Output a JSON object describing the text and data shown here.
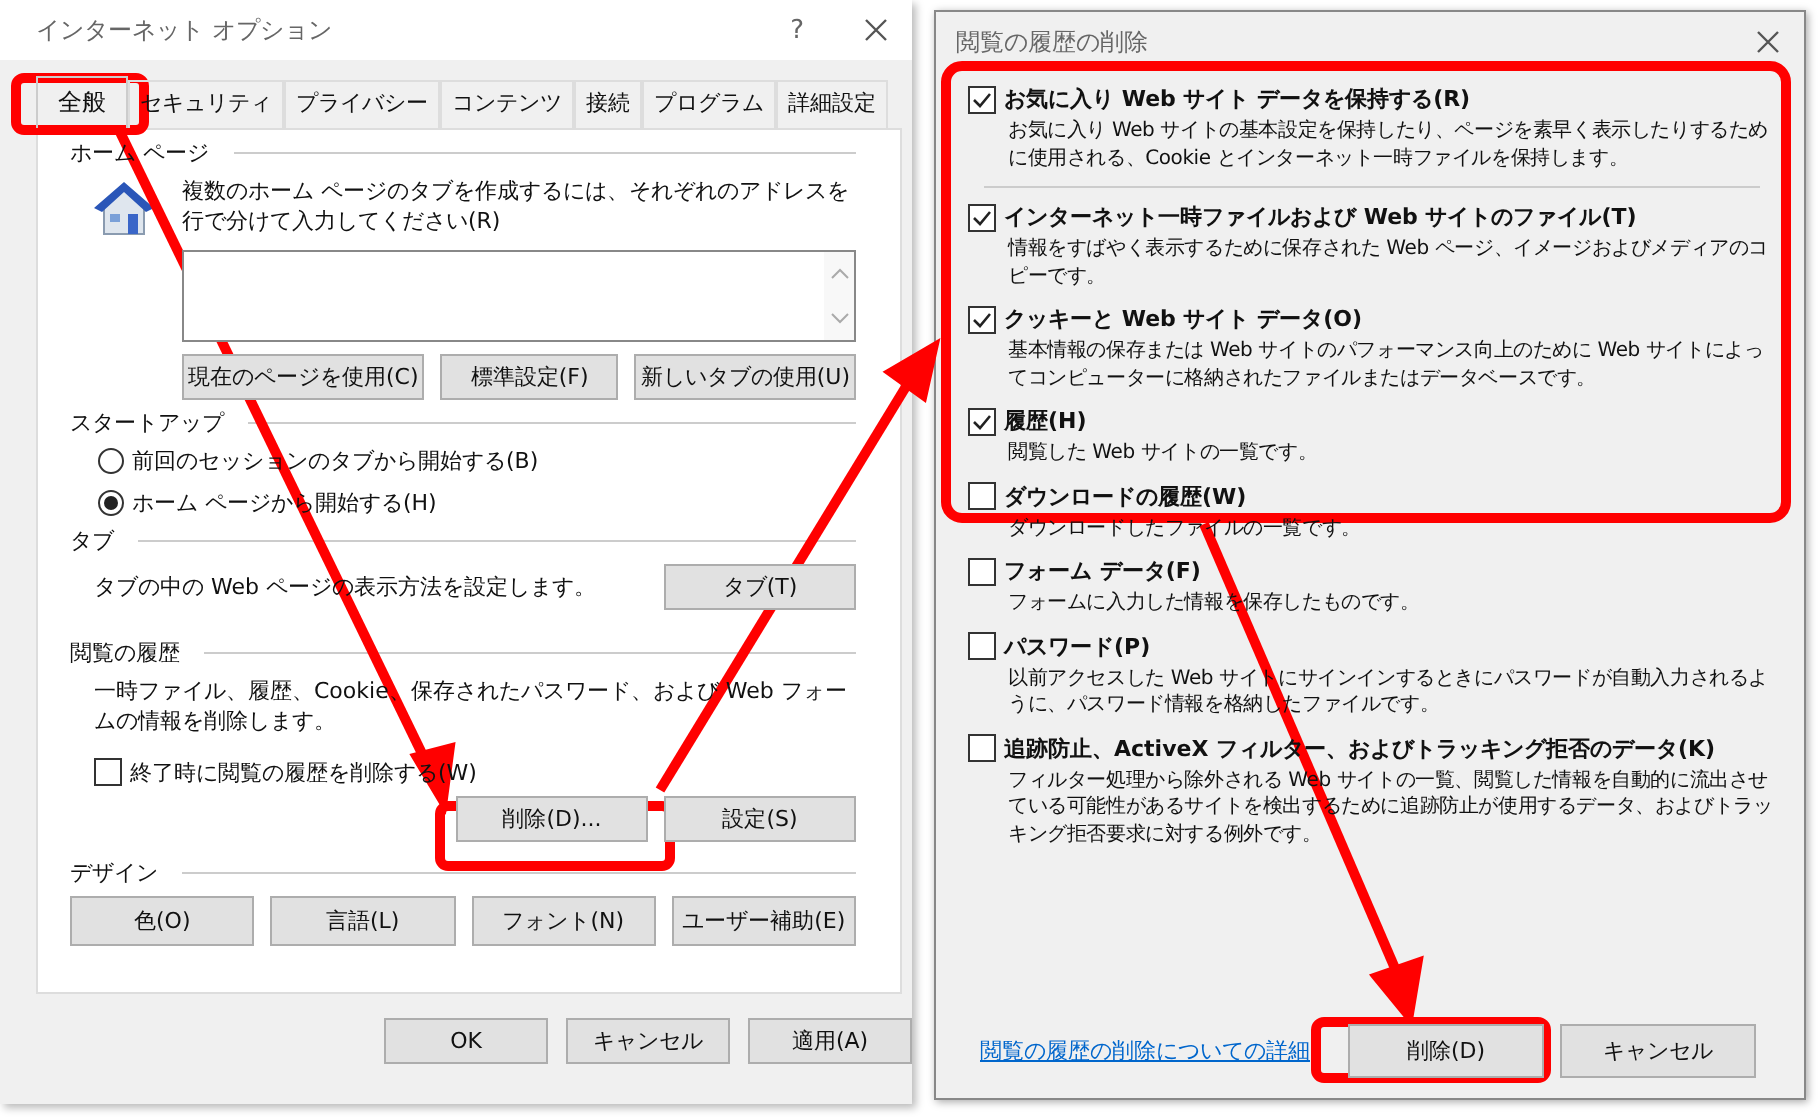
{
  "options_window": {
    "title": "インターネット オプション",
    "help": "?",
    "tabs": [
      {
        "label": "全般",
        "selected": true
      },
      {
        "label": "セキュリティ",
        "selected": false
      },
      {
        "label": "プライバシー",
        "selected": false
      },
      {
        "label": "コンテンツ",
        "selected": false
      },
      {
        "label": "接続",
        "selected": false
      },
      {
        "label": "プログラム",
        "selected": false
      },
      {
        "label": "詳細設定",
        "selected": false
      }
    ],
    "home_page": {
      "heading": "ホーム ページ",
      "description": "複数のホーム ページのタブを作成するには、それぞれのアドレスを行で分けて入力してください(R)",
      "buttons": [
        "現在のページを使用(C)",
        "標準設定(F)",
        "新しいタブの使用(U)"
      ]
    },
    "startup": {
      "heading": "スタートアップ",
      "options": [
        {
          "label": "前回のセッションのタブから開始する(B)",
          "selected": false
        },
        {
          "label": "ホーム ページから開始する(H)",
          "selected": true
        }
      ]
    },
    "tabs_section": {
      "heading": "タブ",
      "description": "タブの中の Web ページの表示方法を設定します。",
      "button": "タブ(T)"
    },
    "history": {
      "heading": "閲覧の履歴",
      "description": "一時ファイル、履歴、Cookie、保存されたパスワード、および Web フォームの情報を削除します。",
      "checkbox": {
        "label": "終了時に閲覧の履歴を削除する(W)",
        "checked": false
      },
      "buttons": [
        "削除(D)...",
        "設定(S)"
      ]
    },
    "design": {
      "heading": "デザイン",
      "buttons": [
        "色(O)",
        "言語(L)",
        "フォント(N)",
        "ユーザー補助(E)"
      ]
    },
    "footer_buttons": [
      "OK",
      "キャンセル",
      "適用(A)"
    ]
  },
  "delete_window": {
    "title": "閲覧の履歴の削除",
    "items": [
      {
        "label": "お気に入り Web サイト データを保持する(R)",
        "checked": true,
        "description": "お気に入り Web サイトの基本設定を保持したり、ページを素早く表示したりするために使用される、Cookie とインターネット一時ファイルを保持します。"
      },
      {
        "label": "インターネット一時ファイルおよび Web サイトのファイル(T)",
        "checked": true,
        "description": "情報をすばやく表示するために保存された Web ページ、イメージおよびメディアのコピーです。"
      },
      {
        "label": "クッキーと Web サイト データ(O)",
        "checked": true,
        "description": "基本情報の保存または Web サイトのパフォーマンス向上のために Web サイトによってコンピューターに格納されたファイルまたはデータベースです。"
      },
      {
        "label": "履歴(H)",
        "checked": true,
        "description": "閲覧した Web サイトの一覧です。"
      },
      {
        "label": "ダウンロードの履歴(W)",
        "checked": false,
        "description": "ダウンロードしたファイルの一覧です。"
      },
      {
        "label": "フォーム データ(F)",
        "checked": false,
        "description": "フォームに入力した情報を保存したものです。"
      },
      {
        "label": "パスワード(P)",
        "checked": false,
        "description": "以前アクセスした Web サイトにサインインするときにパスワードが自動入力されるように、パスワード情報を格納したファイルです。"
      },
      {
        "label": "追跡防止、ActiveX フィルター、およびトラッキング拒否のデータ(K)",
        "checked": false,
        "description": "フィルター処理から除外される Web サイトの一覧、閲覧した情報を自動的に流出させている可能性があるサイトを検出するために追跡防止が使用するデータ、およびトラッキング拒否要求に対する例外です。"
      }
    ],
    "link": "閲覧の履歴の削除についての詳細",
    "buttons": [
      "削除(D)",
      "キャンセル"
    ]
  }
}
